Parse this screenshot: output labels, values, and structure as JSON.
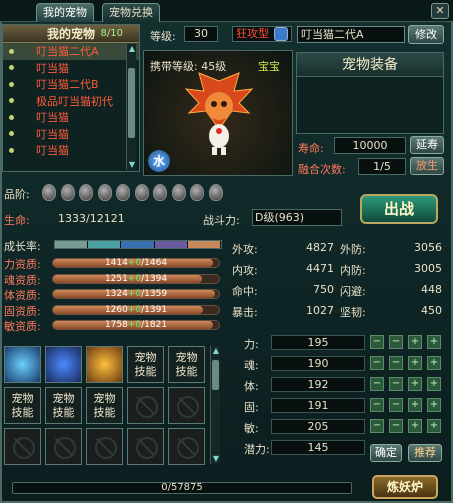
{
  "tabs": [
    {
      "label": "我的宠物"
    },
    {
      "label": "宠物兑换"
    }
  ],
  "close_label": "✕",
  "pet_list": {
    "title": "我的宠物",
    "count": "8/10",
    "items": [
      {
        "name": "叮当猫二代A"
      },
      {
        "name": "叮当猫"
      },
      {
        "name": "叮当猫二代B"
      },
      {
        "name": "极品叮当猫初代"
      },
      {
        "name": "叮当猫"
      },
      {
        "name": "叮当猫"
      },
      {
        "name": "叮当猫"
      }
    ]
  },
  "header": {
    "level_label": "等级:",
    "level_value": "30",
    "type_label": "狂攻型",
    "pet_name": "叮当猫二代A",
    "rename_label": "修改",
    "carry_level": "携带等级: 45级",
    "baobao": "宝宝",
    "element": "水"
  },
  "equip": {
    "title": "宠物装备",
    "lifespan_label": "寿命:",
    "lifespan_value": "10000",
    "extend_label": "延寿",
    "fuse_label": "融合次数:",
    "fuse_value": "1/5",
    "release_label": "放生"
  },
  "quality": {
    "label": "品阶:",
    "eggs": 10
  },
  "life": {
    "label": "生命:",
    "value": "1333/12121"
  },
  "power": {
    "label": "战斗力:",
    "value": "D级(963)"
  },
  "fight_label": "出战",
  "aptitude": {
    "growth_label": "成长率:",
    "growth_colors": [
      "#7a9a96",
      "#4aa0a0",
      "#3a70b0",
      "#6a5aa0",
      "#c88a5a"
    ],
    "rows": [
      {
        "label": "力资质:",
        "base": "1414",
        "plus": "+0",
        "max": "/1464",
        "fraction": 0.966
      },
      {
        "label": "魂资质:",
        "base": "1251",
        "plus": "+0",
        "max": "/1394",
        "fraction": 0.897
      },
      {
        "label": "体资质:",
        "base": "1324",
        "plus": "+0",
        "max": "/1359",
        "fraction": 0.974
      },
      {
        "label": "固资质:",
        "base": "1260",
        "plus": "+0",
        "max": "/1391",
        "fraction": 0.906
      },
      {
        "label": "敏资质:",
        "base": "1758",
        "plus": "+0",
        "max": "/1821",
        "fraction": 0.965
      }
    ]
  },
  "combat": {
    "rows": [
      {
        "l1": "外攻:",
        "v1": "4827",
        "l2": "外防:",
        "v2": "3056"
      },
      {
        "l1": "内攻:",
        "v1": "4471",
        "l2": "内防:",
        "v2": "3005"
      },
      {
        "l1": "命中:",
        "v1": "750",
        "l2": "闪避:",
        "v2": "448"
      },
      {
        "l1": "暴击:",
        "v1": "1027",
        "l2": "坚韧:",
        "v2": "450"
      }
    ]
  },
  "attributes": {
    "rows": [
      {
        "label": "力:",
        "value": "195"
      },
      {
        "label": "魂:",
        "value": "190"
      },
      {
        "label": "体:",
        "value": "192"
      },
      {
        "label": "固:",
        "value": "191"
      },
      {
        "label": "敏:",
        "value": "205"
      },
      {
        "label": "潜力:",
        "value": "145"
      }
    ],
    "confirm_label": "确定",
    "recommend_label": "推荐"
  },
  "skills": {
    "label": "宠物技能",
    "label_line1": "宠物",
    "label_line2": "技能"
  },
  "xp": {
    "value": "0/57875"
  },
  "refine_label": "炼妖炉",
  "colors": {
    "accent": "#ff5a3a",
    "panel": "#0e2221",
    "border": "#4a6a66"
  }
}
